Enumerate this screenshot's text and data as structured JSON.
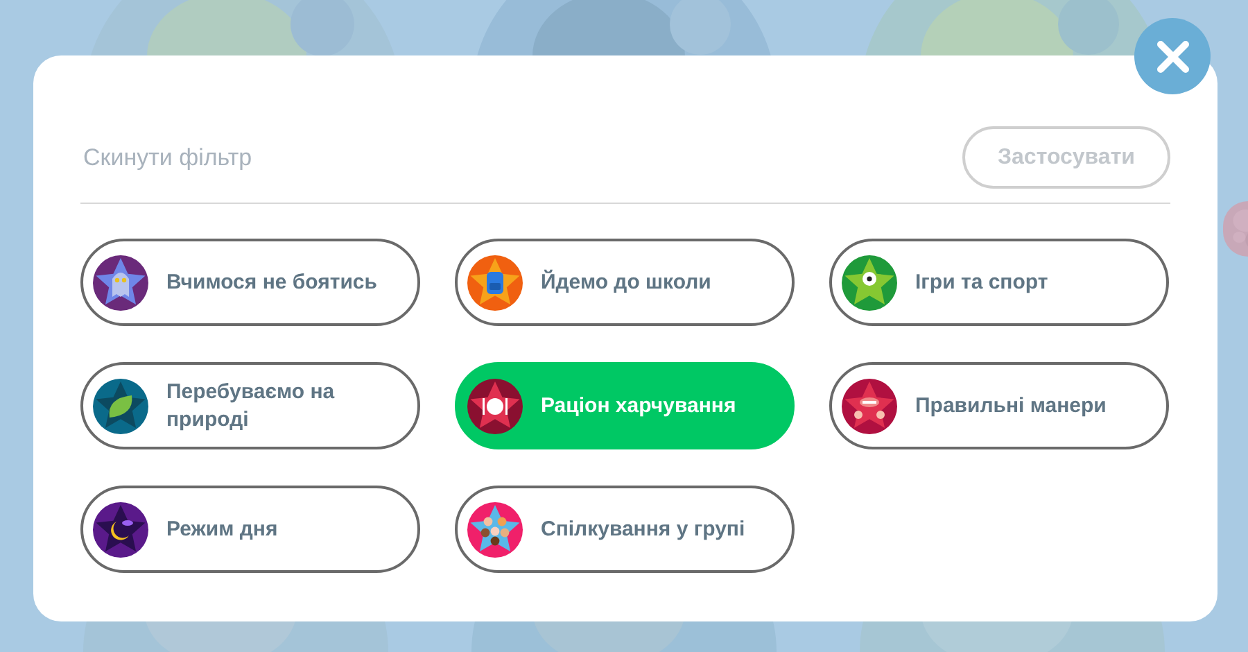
{
  "filter": {
    "reset": "Скинути фільтр",
    "apply": "Застосувати",
    "apply_disabled": true
  },
  "categories": [
    {
      "label": "Вчимося не боятись",
      "selected": false
    },
    {
      "label": "Йдемо до школи",
      "selected": false
    },
    {
      "label": "Ігри та спорт",
      "selected": false
    },
    {
      "label": "Перебуваємо на природі",
      "selected": false
    },
    {
      "label": "Раціон харчування",
      "selected": true
    },
    {
      "label": "Правильні манери",
      "selected": false
    },
    {
      "label": "Режим дня",
      "selected": false
    },
    {
      "label": "Спілкування у групі",
      "selected": false
    }
  ]
}
